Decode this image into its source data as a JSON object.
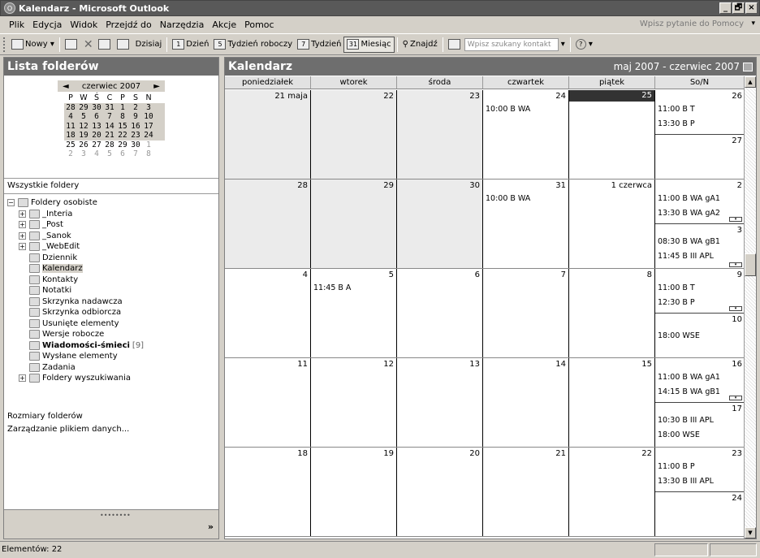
{
  "window": {
    "title": "Kalendarz - Microsoft Outlook",
    "min": "_",
    "max": "🗗",
    "close": "×"
  },
  "menu": {
    "items": [
      "Plik",
      "Edycja",
      "Widok",
      "Przejdź do",
      "Narzędzia",
      "Akcje",
      "Pomoc"
    ],
    "help_placeholder": "Wpisz pytanie do Pomocy"
  },
  "toolbar": {
    "new": "Nowy",
    "today": "Dzisiaj",
    "day": "Dzień",
    "workweek": "Tydzień roboczy",
    "week": "Tydzień",
    "month": "Miesiąc",
    "find": "Znajdź",
    "contact_search_placeholder": "Wpisz szukany kontakt",
    "day_icon": "1",
    "workweek_icon": "5",
    "week_icon": "7",
    "month_icon": "31"
  },
  "left": {
    "header": "Lista folderów",
    "mini_cal": {
      "month": "czerwiec 2007",
      "weekdays": [
        "P",
        "W",
        "Ś",
        "C",
        "P",
        "S",
        "N"
      ],
      "rows": [
        [
          "28",
          "29",
          "30",
          "31",
          "1",
          "2",
          "3"
        ],
        [
          "4",
          "5",
          "6",
          "7",
          "8",
          "9",
          "10"
        ],
        [
          "11",
          "12",
          "13",
          "14",
          "15",
          "16",
          "17"
        ],
        [
          "18",
          "19",
          "20",
          "21",
          "22",
          "23",
          "24"
        ],
        [
          "25",
          "26",
          "27",
          "28",
          "29",
          "30",
          "1"
        ],
        [
          "2",
          "3",
          "4",
          "5",
          "6",
          "7",
          "8"
        ]
      ]
    },
    "all_folders": "Wszystkie foldery",
    "tree": {
      "root": "Foldery osobiste",
      "items": [
        "_Interia",
        "_Post",
        "_Sanok",
        "_WebEdit",
        "Dziennik",
        "Kalendarz",
        "Kontakty",
        "Notatki",
        "Skrzynka nadawcza",
        "Skrzynka odbiorcza",
        "Usunięte elementy",
        "Wersje robocze",
        "Wiadomości-śmieci",
        "Wysłane elementy",
        "Zadania",
        "Foldery wyszukiwania"
      ],
      "junk_count": "[9]"
    },
    "links": [
      "Rozmiary folderów",
      "Zarządzanie plikiem danych..."
    ],
    "chevron": "»"
  },
  "calendar": {
    "title": "Kalendarz",
    "range": "maj 2007 - czerwiec 2007",
    "days": [
      "poniedziałek",
      "wtorek",
      "środa",
      "czwartek",
      "piątek",
      "So/N"
    ],
    "weeks": [
      {
        "d": [
          "21 maja",
          "22",
          "23",
          "24",
          "25"
        ],
        "sat": "26",
        "sun": "27",
        "ev": {
          "3": [
            "10:00 B WA"
          ]
        },
        "sat_ev": [
          "11:00 B T",
          "13:30 B P"
        ],
        "sun_ev": []
      },
      {
        "d": [
          "28",
          "29",
          "30",
          "31",
          "1 czerwca"
        ],
        "sat": "2",
        "sun": "3",
        "ev": {
          "3": [
            "10:00 B WA"
          ]
        },
        "sat_ev": [
          "11:00 B WA gA1",
          "13:30 B WA gA2"
        ],
        "sun_ev": [
          "08:30 B WA gB1",
          "11:45 B III APL"
        ]
      },
      {
        "d": [
          "4",
          "5",
          "6",
          "7",
          "8"
        ],
        "sat": "9",
        "sun": "10",
        "ev": {
          "1": [
            "11:45 B A"
          ]
        },
        "sat_ev": [
          "11:00 B T",
          "12:30 B P"
        ],
        "sun_ev": [
          "18:00 WSE"
        ]
      },
      {
        "d": [
          "11",
          "12",
          "13",
          "14",
          "15"
        ],
        "sat": "16",
        "sun": "17",
        "ev": {},
        "sat_ev": [
          "11:00 B WA gA1",
          "14:15 B WA gB1"
        ],
        "sun_ev": [
          "10:30 B III APL",
          "18:00 WSE"
        ]
      },
      {
        "d": [
          "18",
          "19",
          "20",
          "21",
          "22"
        ],
        "sat": "23",
        "sun": "24",
        "ev": {},
        "sat_ev": [
          "11:00 B P",
          "13:30 B III APL"
        ],
        "sun_ev": []
      }
    ]
  },
  "status": {
    "text": "Elementów: 22"
  }
}
